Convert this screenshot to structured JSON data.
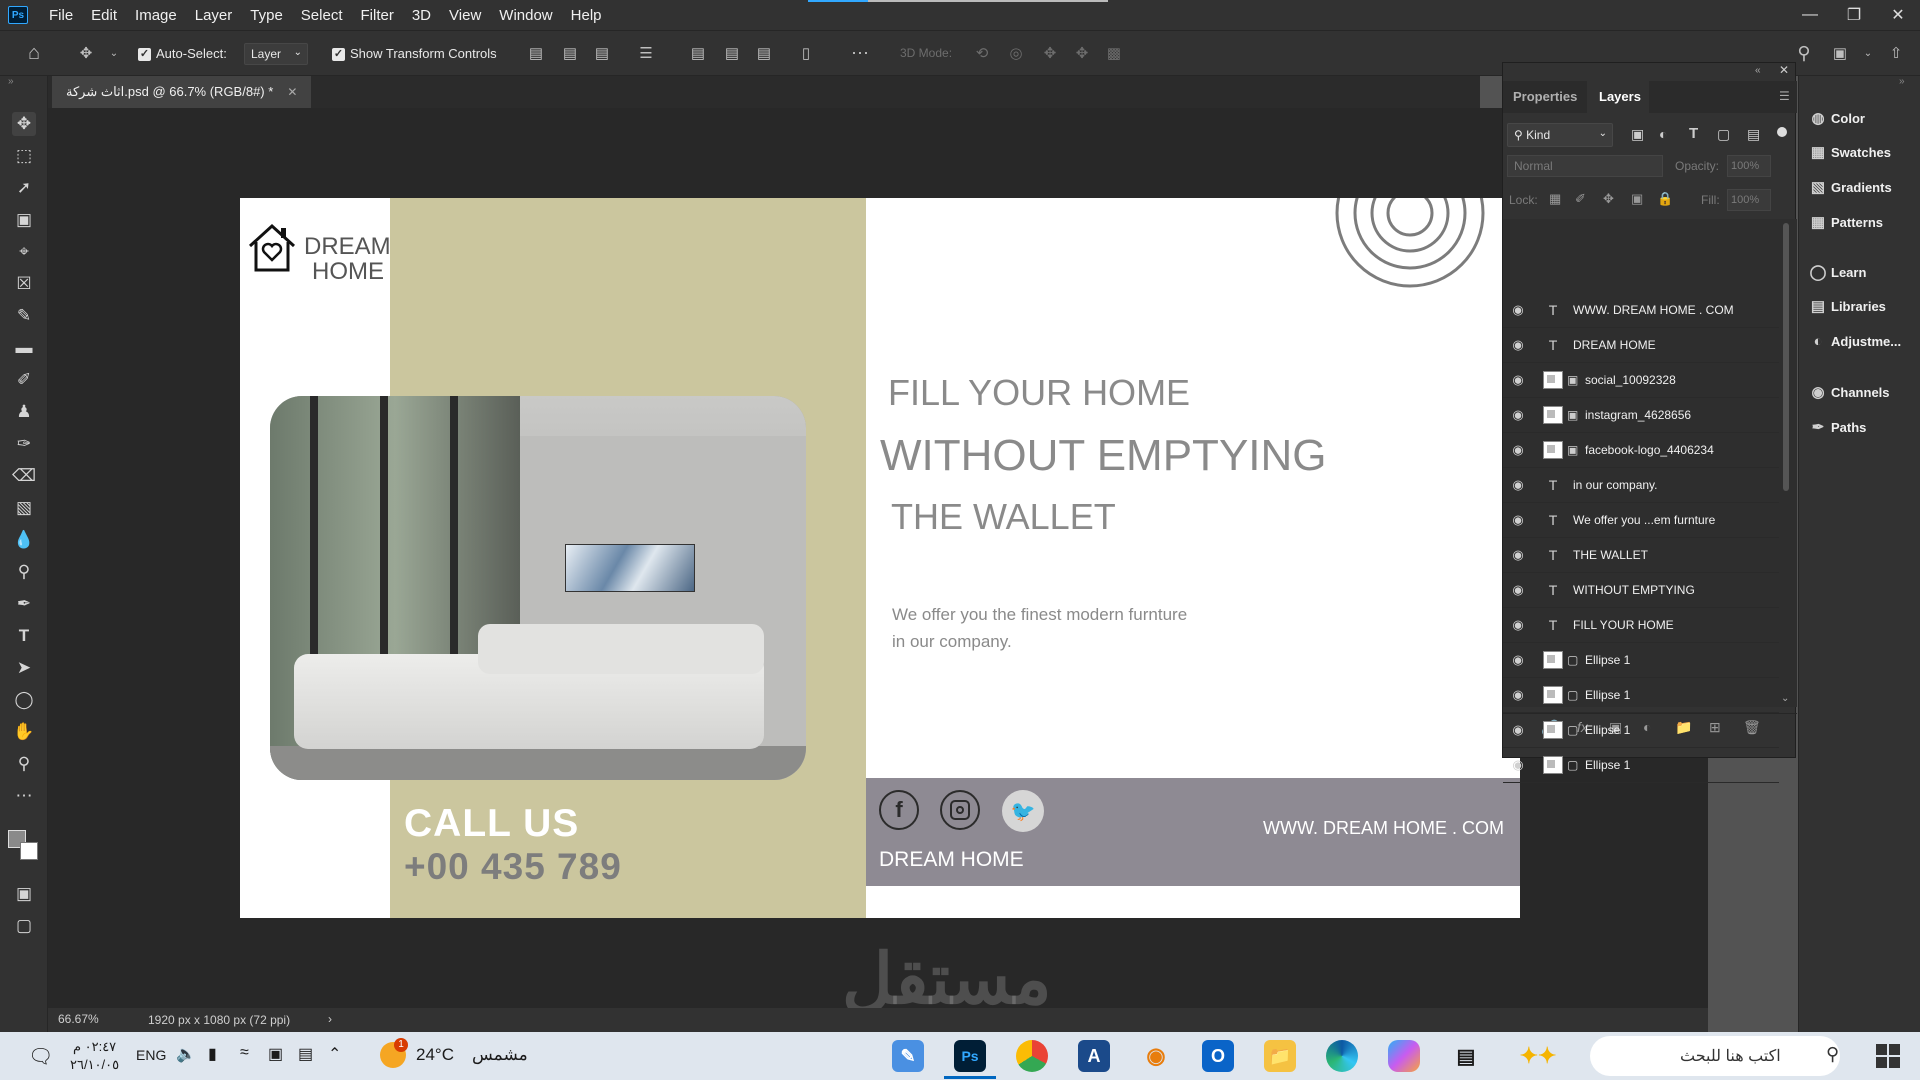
{
  "menubar": {
    "app_icon": "Ps",
    "items": [
      "File",
      "Edit",
      "Image",
      "Layer",
      "Type",
      "Select",
      "Filter",
      "3D",
      "View",
      "Window",
      "Help"
    ]
  },
  "options": {
    "auto_select_label": "Auto-Select:",
    "auto_select_value": "Layer",
    "transform_label": "Show Transform Controls",
    "mode_3d": "3D Mode:"
  },
  "doc_tab": {
    "title": "اثاث شركة.psd @ 66.7% (RGB/8#) *"
  },
  "status": {
    "zoom": "66.67%",
    "info": "1920 px x 1080 px (72 ppi)"
  },
  "design": {
    "logo_line1": "DREAM",
    "logo_line2": "HOME",
    "headline1": "FILL YOUR  HOME",
    "headline2": "WITHOUT EMPTYING",
    "headline3": "THE WALLET",
    "body1": "We offer you the finest modern furnture",
    "body2": "in our company.",
    "call_us": "CALL US",
    "phone": "+00 435 789",
    "footer_brand": "DREAM HOME",
    "footer_url": "WWW. DREAM HOME . COM",
    "colors": {
      "beige": "#cbc69e",
      "gray_band": "#8e8a93",
      "text_gray": "#8a8a8a"
    }
  },
  "panel": {
    "tabs": [
      "Properties",
      "Layers"
    ],
    "filter_kind": "Kind",
    "blend": "Normal",
    "opacity_label": "Opacity:",
    "opacity_value": "100%",
    "lock_label": "Lock:",
    "fill_label": "Fill:",
    "fill_value": "100%",
    "layers": [
      {
        "name": "WWW. DREAM HOME . COM",
        "kind": "text"
      },
      {
        "name": "DREAM HOME",
        "kind": "text"
      },
      {
        "name": "social_10092328",
        "kind": "smart"
      },
      {
        "name": "instagram_4628656",
        "kind": "smart"
      },
      {
        "name": "facebook-logo_4406234",
        "kind": "smart"
      },
      {
        "name": "in our company.",
        "kind": "text"
      },
      {
        "name": "We offer you ...em furnture",
        "kind": "text"
      },
      {
        "name": "THE WALLET",
        "kind": "text"
      },
      {
        "name": "WITHOUT EMPTYING",
        "kind": "text"
      },
      {
        "name": "FILL YOUR  HOME",
        "kind": "text"
      },
      {
        "name": "Ellipse 1",
        "kind": "shape"
      },
      {
        "name": "Ellipse 1",
        "kind": "shape"
      },
      {
        "name": "Ellipse 1",
        "kind": "shape"
      },
      {
        "name": "Ellipse 1",
        "kind": "shape"
      }
    ]
  },
  "dock": [
    "Color",
    "Swatches",
    "Gradients",
    "Patterns",
    "Learn",
    "Libraries",
    "Adjustme...",
    "Channels",
    "Paths"
  ],
  "taskbar": {
    "search_placeholder": "اكتب هنا للبحث",
    "weather_temp": "24°C",
    "weather_text": "مشمس",
    "lang": "ENG",
    "time": "٠٢:٤٧ م",
    "date": "٢٦/١٠/٠٥",
    "notif_count": "1"
  },
  "watermark": "مستقل"
}
